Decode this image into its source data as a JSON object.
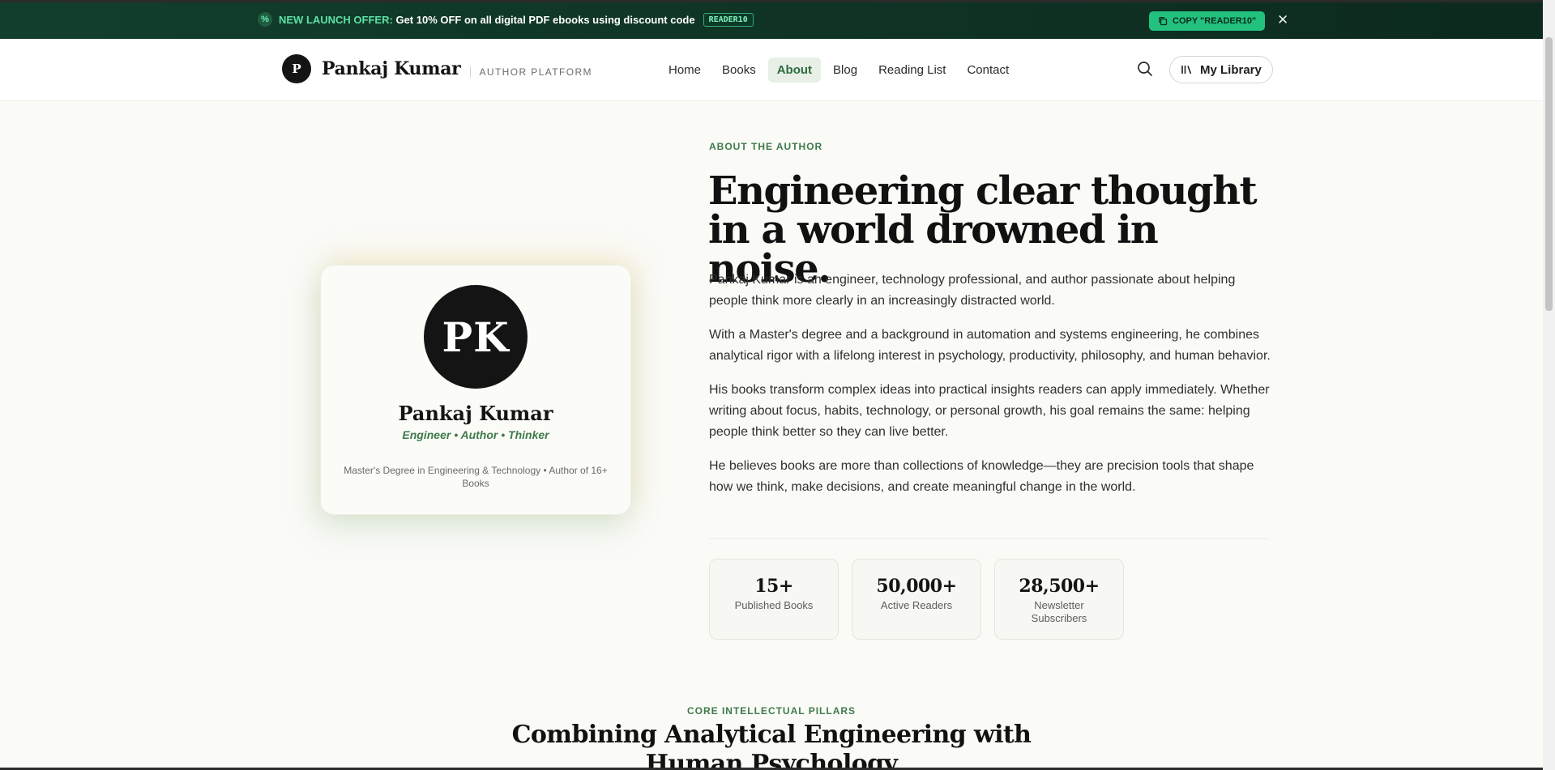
{
  "promo": {
    "highlight": "NEW LAUNCH OFFER:",
    "text": "Get 10% OFF on all digital PDF ebooks using discount code",
    "code": "READER10",
    "copy_label": "COPY \"READER10\"",
    "close_glyph": "✕"
  },
  "header": {
    "logo_letter": "P",
    "name": "Pankaj Kumar",
    "subtitle": "AUTHOR PLATFORM",
    "nav": [
      {
        "label": "Home"
      },
      {
        "label": "Books"
      },
      {
        "label": "About"
      },
      {
        "label": "Blog"
      },
      {
        "label": "Reading List"
      },
      {
        "label": "Contact"
      }
    ],
    "active_nav": "About",
    "library_label": "My Library"
  },
  "profile": {
    "initials": "PK",
    "name": "Pankaj Kumar",
    "tagline": "Engineer • Author • Thinker",
    "credentials": "Master's Degree in Engineering & Technology • Author of 16+ Books"
  },
  "about": {
    "eyebrow": "ABOUT THE AUTHOR",
    "title": "Engineering clear thought in a world drowned in noise.",
    "paragraphs": [
      "Pankaj Kumar is an engineer, technology professional, and author passionate about helping people think more clearly in an increasingly distracted world.",
      "With a Master's degree and a background in automation and systems engineering, he combines analytical rigor with a lifelong interest in psychology, productivity, philosophy, and human behavior.",
      "His books transform complex ideas into practical insights readers can apply immediately. Whether writing about focus, habits, technology, or personal growth, his goal remains the same: helping people think better so they can live better.",
      "He believes books are more than collections of knowledge—they are precision tools that shape how we think, make decisions, and create meaningful change in the world."
    ],
    "stats": [
      {
        "value": "15+",
        "label": "Published Books"
      },
      {
        "value": "50,000+",
        "label": "Active Readers"
      },
      {
        "value": "28,500+",
        "label": "Newsletter Subscribers"
      }
    ]
  },
  "pillars": {
    "eyebrow": "CORE INTELLECTUAL PILLARS",
    "title": "Combining Analytical Engineering with Human Psychology"
  },
  "colors": {
    "accent": "#3f7a4b",
    "banner": "#0f3324",
    "copy_button": "#22c17d"
  }
}
